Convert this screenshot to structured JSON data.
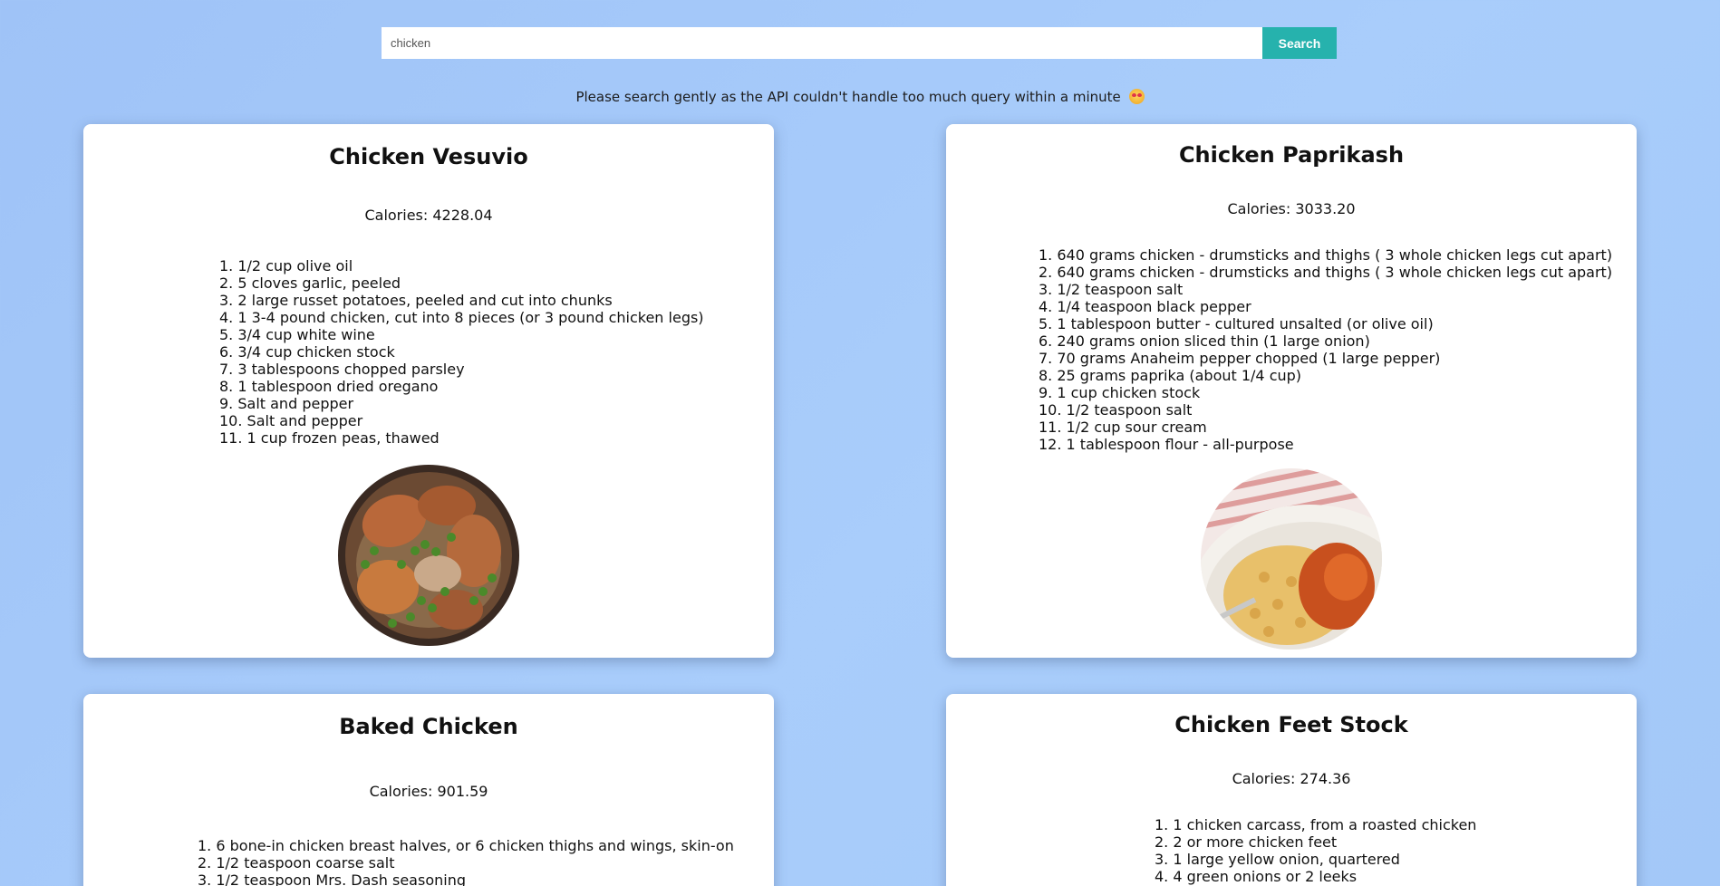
{
  "search": {
    "value": "chicken",
    "button_label": "Search"
  },
  "notice": {
    "text": "Please search gently as the API couldn't handle too much query within a minute"
  },
  "recipes": [
    {
      "title": "Chicken Vesuvio",
      "calories": "Calories: 4228.04",
      "ingredients": [
        "1/2 cup olive oil",
        "5 cloves garlic, peeled",
        "2 large russet potatoes, peeled and cut into chunks",
        "1 3-4 pound chicken, cut into 8 pieces (or 3 pound chicken legs)",
        "3/4 cup white wine",
        "3/4 cup chicken stock",
        "3 tablespoons chopped parsley",
        "1 tablespoon dried oregano",
        "Salt and pepper",
        "Salt and pepper",
        "1 cup frozen peas, thawed"
      ],
      "image": "chicken-vesuvio-photo"
    },
    {
      "title": "Chicken Paprikash",
      "calories": "Calories: 3033.20",
      "ingredients": [
        "640 grams chicken - drumsticks and thighs ( 3 whole chicken legs cut apart)",
        "640 grams chicken - drumsticks and thighs ( 3 whole chicken legs cut apart)",
        "1/2 teaspoon salt",
        "1/4 teaspoon black pepper",
        "1 tablespoon butter - cultured unsalted (or olive oil)",
        "240 grams onion sliced thin (1 large onion)",
        "70 grams Anaheim pepper chopped (1 large pepper)",
        "25 grams paprika (about 1/4 cup)",
        "1 cup chicken stock",
        "1/2 teaspoon salt",
        "1/2 cup sour cream",
        "1 tablespoon flour - all-purpose"
      ],
      "image": "chicken-paprikash-photo"
    },
    {
      "title": "Baked Chicken",
      "calories": "Calories: 901.59",
      "ingredients": [
        "6 bone-in chicken breast halves, or 6 chicken thighs and wings, skin-on",
        "1/2 teaspoon coarse salt",
        "1/2 teaspoon Mrs. Dash seasoning"
      ]
    },
    {
      "title": "Chicken Feet Stock",
      "calories": "Calories: 274.36",
      "ingredients": [
        "1 chicken carcass, from a roasted chicken",
        "2 or more chicken feet",
        "1 large yellow onion, quartered",
        "4 green onions or 2 leeks"
      ]
    }
  ],
  "colors": {
    "background": "#a6c9f9",
    "search_button": "#26b2ad",
    "card": "#ffffff"
  }
}
